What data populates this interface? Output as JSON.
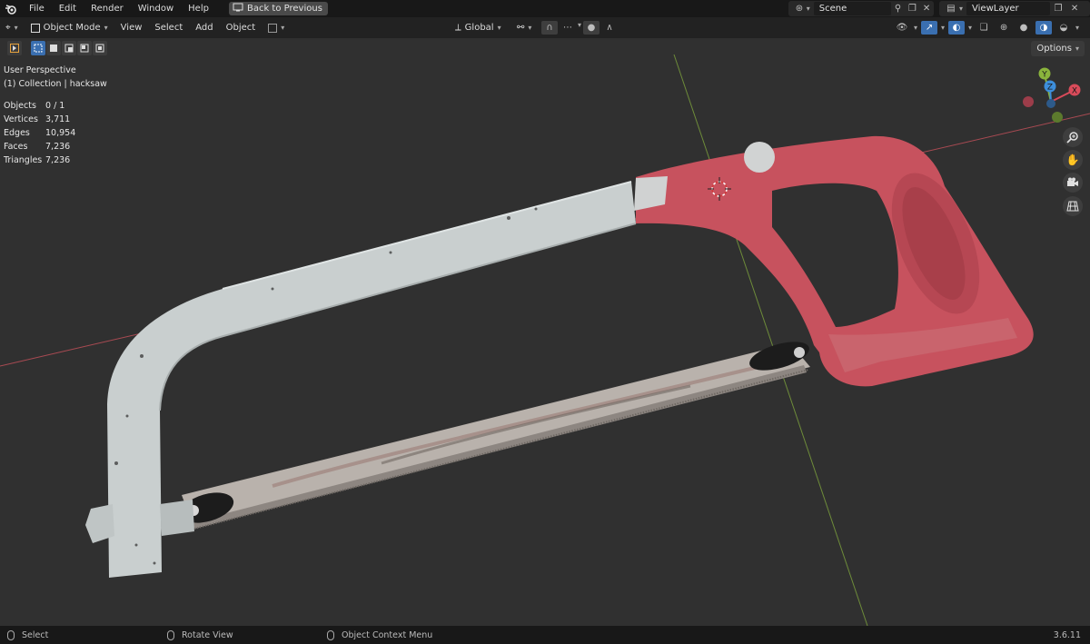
{
  "menu": {
    "items": [
      "File",
      "Edit",
      "Render",
      "Window",
      "Help"
    ],
    "back_label": "Back to Previous"
  },
  "scene": {
    "label": "Scene",
    "view_layer": "ViewLayer"
  },
  "header": {
    "mode": "Object Mode",
    "view": "View",
    "select": "Select",
    "add": "Add",
    "object": "Object",
    "orientation": "Global"
  },
  "toolrow": {
    "options": "Options"
  },
  "viewport": {
    "perspective": "User Perspective",
    "collection": "(1) Collection | hacksaw",
    "stats": [
      {
        "label": "Objects",
        "value": "0 / 1"
      },
      {
        "label": "Vertices",
        "value": "3,711"
      },
      {
        "label": "Edges",
        "value": "10,954"
      },
      {
        "label": "Faces",
        "value": "7,236"
      },
      {
        "label": "Triangles",
        "value": "7,236"
      }
    ]
  },
  "gizmo": {
    "x": "X",
    "y": "Y",
    "z": "Z"
  },
  "status": {
    "select": "Select",
    "rotate": "Rotate View",
    "context": "Object Context Menu",
    "version": "3.6.11"
  },
  "colors": {
    "handle": "#c7525e",
    "frame": "#c9cfcf",
    "x_axis": "#d94b5a",
    "y_axis": "#8ab43c",
    "z_axis": "#3d8edb"
  }
}
